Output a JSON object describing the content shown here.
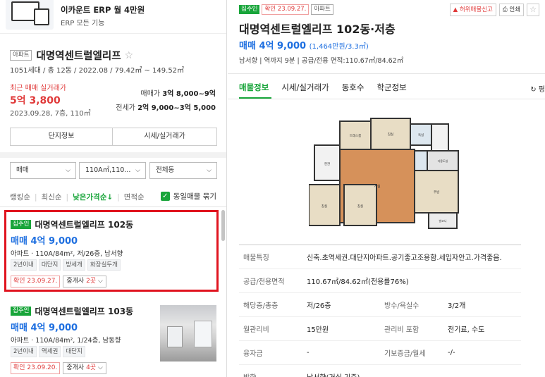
{
  "ad": {
    "title": "이카운트 ERP 월 4만원",
    "subtitle": "ERP 모든 기능"
  },
  "complex": {
    "type_tag": "아파트",
    "name": "대명역센트럴엘리프",
    "meta": "1051세대 / 총 12동 / 2022.08 / 79.42㎡ ~ 149.52㎡",
    "recent_label": "최근 매매 실거래가",
    "recent_price": "5억 3,800",
    "recent_date": "2023.09.28, 7층, 110㎡",
    "sale_label": "매매가",
    "sale_range": "3억 8,000~9억",
    "lease_label": "전세가",
    "lease_range": "2억 9,000~3억 5,000",
    "btn_info": "단지정보",
    "btn_trade": "시세/실거래가"
  },
  "filters": {
    "deal": "매매",
    "area": "110A㎡,110...",
    "dong": "전체동"
  },
  "sort": {
    "options": [
      "랭킹순",
      "최신순",
      "낮은가격순↓",
      "면적순"
    ],
    "active_index": 2,
    "same_label": "동일매물 묶기",
    "same_checked": true
  },
  "listings": [
    {
      "owner_tag": "집주인",
      "title": "대명역센트럴엘리프 102동",
      "price": "매매 4억 9,000",
      "info": "아파트 · 110A/84m², 저/26층, 남서향",
      "tags": [
        "2년이내",
        "대단지",
        "방세개",
        "화장실두개"
      ],
      "confirm": "확인 23.09.27.",
      "broker_prefix": "중개사 ",
      "broker_count": "2곳"
    },
    {
      "owner_tag": "집주인",
      "title": "대명역센트럴엘리프 103동",
      "price": "매매 4억 9,000",
      "info": "아파트 · 110A/84m², 1/24층, 남동향",
      "tags": [
        "2년이내",
        "역세권",
        "대단지"
      ],
      "confirm": "확인 23.09.20.",
      "broker_prefix": "중개사 ",
      "broker_count": "4곳"
    }
  ],
  "detail": {
    "owner_tag": "집주인",
    "confirm": "확인 23.09.27.",
    "type_tag": "아파트",
    "report_label": "허위매물신고",
    "print_label": "인쇄",
    "title": "대명역센트럴엘리프 102동·저층",
    "price": "매매 4억 9,000",
    "price_per": "(1,464만원/3.3㎡)",
    "meta": "남서향 | 역까지 9분 | 공급/전용 면적:110.67㎡/84.62㎡",
    "tabs": [
      "매물정보",
      "시세/실거래가",
      "동호수",
      "학군정보"
    ],
    "active_tab": 0,
    "refresh": "평",
    "plan_labels": {
      "dress": "드레스룸",
      "bath": "욕실",
      "room": "침실",
      "living": "거실",
      "kitchen": "주방",
      "balcony": "발코니",
      "entrance": "현관",
      "utility": "다용도실"
    },
    "specs": [
      {
        "k": "매물특징",
        "v": "신축.초역세권.대단지아파트.공기좋고조용함.세입자안고.가격좋음."
      },
      {
        "k": "공급/전용면적",
        "v": "110.67㎡/84.62㎡(전용률76%)"
      },
      {
        "k": "해당층/총층",
        "v": "저/26층",
        "k2": "방수/욕실수",
        "v2": "3/2개"
      },
      {
        "k": "월관리비",
        "v": "15만원",
        "k2": "관리비 포함",
        "v2": "전기료, 수도"
      },
      {
        "k": "융자금",
        "v": "-",
        "k2": "기보증금/월세",
        "v2": "-/-"
      },
      {
        "k": "방향",
        "v": "남서향(거실 기준)"
      }
    ]
  }
}
